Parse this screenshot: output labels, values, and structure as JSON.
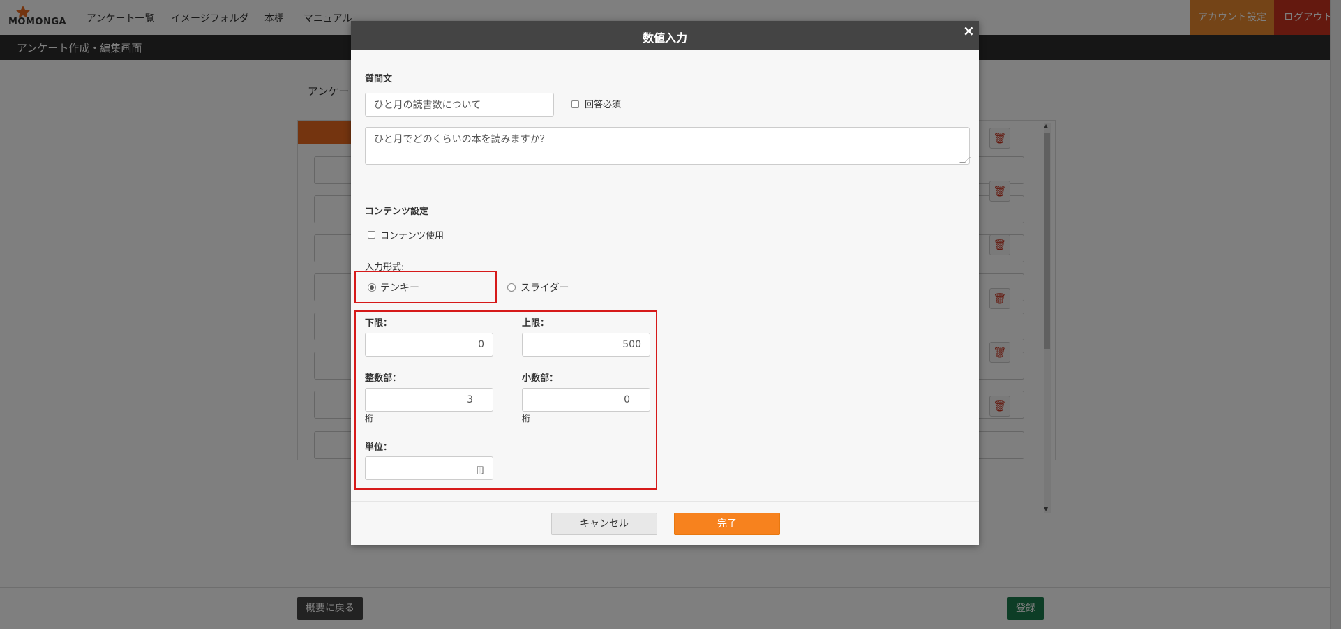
{
  "app": {
    "logo_text": "MOMONGA",
    "nav": [
      "アンケート一覧",
      "イメージフォルダ",
      "本棚",
      "マニュアル"
    ],
    "account_label": "アカウント設定",
    "logout_label": "ログアウト",
    "page_title": "アンケート作成・編集画面",
    "section_heading": "アンケー",
    "back_label": "概要に戻る",
    "register_label": "登録",
    "trash_icon": "trash-icon"
  },
  "modal": {
    "title": "数値入力",
    "close_symbol": "×",
    "question_label": "質問文",
    "question_value": "ひと月の読書数について",
    "required_label": "回答必須",
    "required_checked": false,
    "description_value": "ひと月でどのくらいの本を読みますか？",
    "content_settings_label": "コンテンツ設定",
    "content_use_label": "コンテンツ使用",
    "content_use_checked": false,
    "input_type_label": "入力形式:",
    "input_types": [
      {
        "label": "テンキー",
        "selected": true
      },
      {
        "label": "スライダー",
        "selected": false
      }
    ],
    "lower_label": "下限：",
    "lower_value": "0",
    "upper_label": "上限：",
    "upper_value": "500",
    "integer_label": "整数部：",
    "integer_value": "3",
    "decimal_label": "小数部：",
    "decimal_value": "0",
    "digits_unit": "桁",
    "unit_label": "単位：",
    "unit_value": "",
    "unit_icon_glyph": "冊",
    "cancel_label": "キャンセル",
    "done_label": "完了"
  },
  "colors": {
    "accent_orange": "#f7821e",
    "account_orange": "#e8882e",
    "logout_red": "#c8331e",
    "highlight_red": "#d61a1a",
    "register_green": "#1a7a4c",
    "header_dark": "#444444"
  }
}
